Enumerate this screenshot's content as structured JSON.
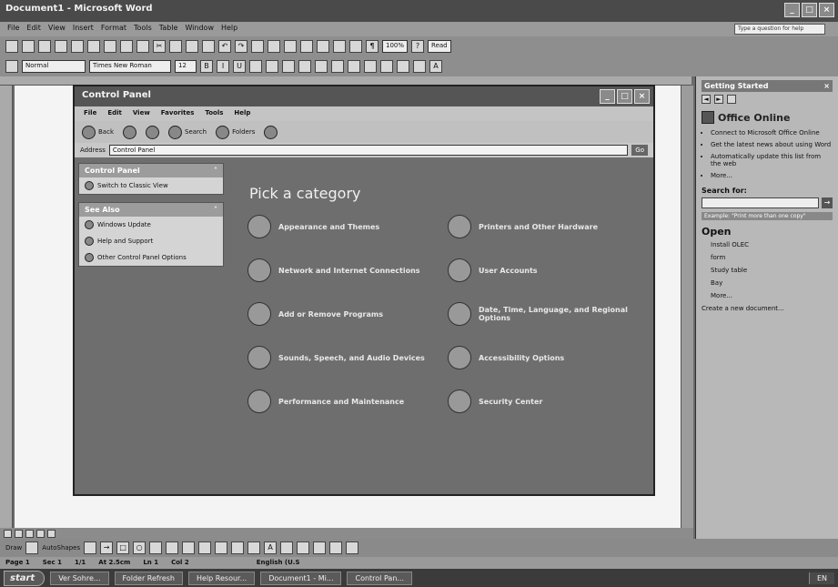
{
  "word": {
    "title": "Document1 - Microsoft Word",
    "menu": [
      "File",
      "Edit",
      "View",
      "Insert",
      "Format",
      "Tools",
      "Table",
      "Window",
      "Help"
    ],
    "help_placeholder": "Type a question for help",
    "zoom": "100%",
    "read_label": "Read",
    "style": "Normal",
    "font": "Times New Roman",
    "font_size": "12"
  },
  "status": {
    "page": "Page 1",
    "section": "Sec 1",
    "pages": "1/1",
    "at": "At 2.5cm",
    "line": "Ln 1",
    "col": "Col 2",
    "language": "English (U.S"
  },
  "drawing": {
    "draw_label": "Draw",
    "autoshapes_label": "AutoShapes"
  },
  "taskbar": {
    "start_label": "start",
    "tasks": [
      "Ver Sohre...",
      "Folder Refresh",
      "Help Resour...",
      "Document1 - Mi...",
      "Control Pan..."
    ],
    "clock": "EN"
  },
  "task_pane": {
    "header": "Getting Started",
    "office_online": "Office Online",
    "links": [
      "Connect to Microsoft Office Online",
      "Get the latest news about using Word",
      "Automatically update this list from the web",
      "More..."
    ],
    "search_label": "Search for:",
    "example": "Example: \"Print more than one copy\"",
    "open_title": "Open",
    "open_items": [
      "Install OLEC",
      "form",
      "Study table",
      "Bay",
      "More..."
    ],
    "create_label": "Create a new document..."
  },
  "control_panel": {
    "title": "Control Panel",
    "menu": [
      "File",
      "Edit",
      "View",
      "Favorites",
      "Tools",
      "Help"
    ],
    "toolbar": {
      "back": "Back",
      "search": "Search",
      "folders": "Folders"
    },
    "address_label": "Address",
    "address_value": "Control Panel",
    "go_label": "Go",
    "left_header": "Control Panel",
    "switch_view": "Switch to Classic View",
    "see_also_header": "See Also",
    "see_also": [
      "Windows Update",
      "Help and Support",
      "Other Control Panel Options"
    ],
    "pick_title": "Pick a category",
    "categories": [
      "Appearance and Themes",
      "Printers and Other Hardware",
      "Network and Internet Connections",
      "User Accounts",
      "Add or Remove Programs",
      "Date, Time, Language, and Regional Options",
      "Sounds, Speech, and Audio Devices",
      "Accessibility Options",
      "Performance and Maintenance",
      "Security Center"
    ]
  }
}
